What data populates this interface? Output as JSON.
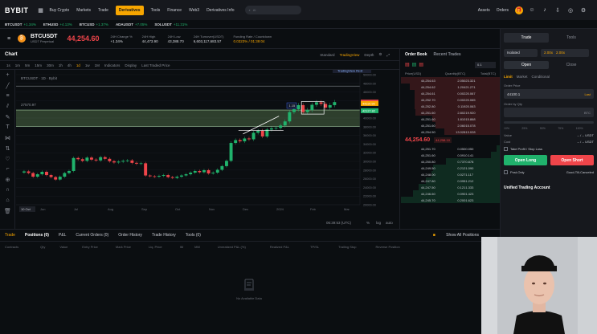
{
  "topnav": {
    "logo": "BYBIT",
    "items": [
      "Buy Crypto",
      "Markets",
      "Trade",
      "Derivatives",
      "Tools",
      "Finance",
      "Web3",
      "Derivatives Info"
    ],
    "active_index": 3,
    "search_placeholder": "Al",
    "right": [
      "Assets",
      "Orders"
    ]
  },
  "tickers": [
    {
      "symbol": "BTCUSDT",
      "change": "+1.34%"
    },
    {
      "symbol": "ETHUSD",
      "change": "+4.13%"
    },
    {
      "symbol": "BTCUSD",
      "change": "+1.37%"
    },
    {
      "symbol": "ADAUSDT",
      "change": "+7.05%"
    },
    {
      "symbol": "SOLUSDT",
      "change": "+11.31%"
    }
  ],
  "header": {
    "symbol": "BTCUSDT",
    "subtitle": "USDT Perpetual",
    "price": "44,254.60",
    "stats": [
      {
        "label": "24H Change %",
        "value": "+1.34%"
      },
      {
        "label": "24H High",
        "value": "44,473.90"
      },
      {
        "label": "24H Low",
        "value": "43,388.70"
      },
      {
        "label": "24H Turnover(USDT)",
        "value": "6,603,117,683.57"
      },
      {
        "label": "Funding Rate / Countdown",
        "value": "0.0323% / 01:39:04"
      }
    ]
  },
  "chart": {
    "title": "Chart",
    "views": [
      "Standard",
      "TradingView",
      "Depth"
    ],
    "active_view": 1,
    "intervals": [
      "1s",
      "1m",
      "5m",
      "15m",
      "30m",
      "1h",
      "4h",
      "1d",
      "1w",
      "1M"
    ],
    "active_interval": 7,
    "tools": [
      "Indicators",
      "Display",
      "Last Traded Price"
    ],
    "overlay_title": "BTCUSDT · 1D · Bybit",
    "overlay_price": "27570.97",
    "tv_badge": "TradingView Rest",
    "bottom_left": "10 Oct",
    "bottom_time": "06:39:53 (UTC)",
    "bottom_opts": [
      "%",
      "log",
      "auto"
    ],
    "x_labels": [
      "Jun",
      "Jul",
      "Aug",
      "Sep",
      "Oct",
      "Nov",
      "Dec",
      "2024",
      "Feb",
      "Mar"
    ],
    "y_labels": [
      "50000.00",
      "48000.00",
      "46000.00",
      "44000.00",
      "42000.00",
      "40000.00",
      "38000.00",
      "36000.00",
      "34000.00",
      "32000.00",
      "30000.00",
      "28000.00",
      "26000.00",
      "24000.00",
      "22000.00",
      "20000.00"
    ],
    "tags": [
      {
        "text": "44254.60",
        "color": "#ef454a"
      },
      {
        "text": "44110.99",
        "color": "#f7a600"
      },
      {
        "text": "42127.82",
        "color": "#20b26c"
      }
    ],
    "callout": "1.15"
  },
  "chart_data": {
    "type": "line",
    "title": "",
    "xlabel": "",
    "ylabel": "",
    "ylim": [
      19000,
      51000
    ],
    "x_months": [
      "Jun",
      "Jul",
      "Aug",
      "Sep",
      "Oct",
      "Nov",
      "Dec",
      "2024",
      "Feb",
      "Mar"
    ],
    "candles_close": [
      27200,
      26800,
      25900,
      26500,
      27100,
      26300,
      25800,
      25200,
      25900,
      26800,
      27300,
      30500,
      30200,
      29800,
      30600,
      30100,
      29900,
      30700,
      30300,
      29700,
      29400,
      29600,
      29800,
      29900,
      29300,
      29100,
      29200,
      26200,
      26000,
      25900,
      26100,
      26300,
      25800,
      25600,
      25900,
      26200,
      26500,
      26900,
      27300,
      27000,
      27500,
      26700,
      26900,
      27600,
      28500,
      29800,
      34200,
      34900,
      34600,
      35300,
      35100,
      36700,
      37200,
      35800,
      37500,
      37800,
      37900,
      38500,
      39500,
      41800,
      42500,
      43500,
      41800,
      42300,
      43600,
      44200,
      43800,
      42900,
      43500,
      44250
    ]
  },
  "orderbook": {
    "tabs": [
      "Order Book",
      "Recent Trades"
    ],
    "precision": "0.1",
    "cols": [
      "Price(USD)",
      "Quantity(BTC)",
      "Total(BTC)"
    ],
    "asks": [
      [
        "44,254.63",
        "2.050",
        "23.321"
      ],
      [
        "44,254.62",
        "1.204",
        "21.271"
      ],
      [
        "44,254.61",
        "0.002",
        "20.067"
      ],
      [
        "44,252.70",
        "0.002",
        "20.065"
      ],
      [
        "44,252.80",
        "0.119",
        "20.063"
      ],
      [
        "44,251.60",
        "2.802",
        "19.920"
      ],
      [
        "44,251.60",
        "1.810",
        "15.868"
      ],
      [
        "44,251.60",
        "2.060",
        "15.078"
      ],
      [
        "44,254.50",
        "13.028",
        "13.028"
      ]
    ],
    "mid": "44,254.60",
    "mark": "44,258.10",
    "bids": [
      [
        "44,251.70",
        "0.050",
        "0.050"
      ],
      [
        "44,251.60",
        "0.091",
        "0.141"
      ],
      [
        "44,250.80",
        "0.737",
        "0.878"
      ],
      [
        "44,249.50",
        "0.212",
        "1.090"
      ],
      [
        "44,248.00",
        "0.027",
        "1.117"
      ],
      [
        "44,247.80",
        "0.095",
        "1.212"
      ],
      [
        "44,247.50",
        "0.121",
        "1.333"
      ],
      [
        "44,246.60",
        "0.090",
        "1.423"
      ],
      [
        "44,245.70",
        "0.200",
        "1.623"
      ]
    ]
  },
  "tradepanel": {
    "tabs": [
      "Trade",
      "Tools"
    ],
    "margin_mode": "Isolated",
    "leverage": "2.00x",
    "leverage2": "2.00x",
    "oc": [
      "Open",
      "Close"
    ],
    "order_types": [
      "Limit",
      "Market",
      "Conditional"
    ],
    "order_price_label": "Order Price",
    "order_price": "44100.1",
    "last_label": "Last",
    "qty_label": "Order by Qty",
    "qty_unit": "BTC",
    "pcts": [
      "10%",
      "25%",
      "50%",
      "75%",
      "100%"
    ],
    "value_label": "Value",
    "value": "-- / -- USDT",
    "cost_label": "Cost",
    "cost": "-- / -- USDT",
    "tpsl": "Take Profit / Stop Loss",
    "long": "Open Long",
    "short": "Open Short",
    "post_only": "Post-Only",
    "gtc": "Good-Till-Canceled",
    "uta": "Unified Trading Account"
  },
  "positions": {
    "tabs": [
      "Trade",
      "Positions (0)",
      "P&L",
      "Current Orders (0)",
      "Order History",
      "Trade History",
      "Tools (0)"
    ],
    "active_index": 1,
    "show_all": "Show All Positions",
    "cols": [
      "Contracts",
      "Qty",
      "Value",
      "Entry Price",
      "Mark Price",
      "Liq. Price",
      "IM",
      "MM",
      "Unrealized P&L (%)",
      "Realized P&L",
      "TP/SL",
      "Trailing Stop",
      "Reverse Position"
    ],
    "empty": "No Available Data"
  }
}
